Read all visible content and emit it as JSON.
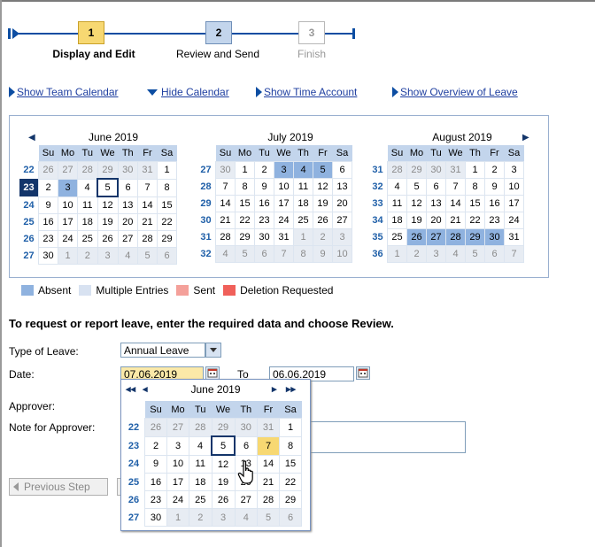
{
  "roadmap": {
    "steps": [
      {
        "num": "1",
        "label": "Display and Edit",
        "state": "active"
      },
      {
        "num": "2",
        "label": "Review and Send",
        "state": "pending"
      },
      {
        "num": "3",
        "label": "Finish",
        "state": "disabled"
      }
    ]
  },
  "links": {
    "team_calendar": "Show Team Calendar",
    "hide_calendar": "Hide Calendar",
    "time_account": "Show Time Account",
    "overview_leave": "Show Overview of Leave"
  },
  "calendar": {
    "weekday_headers": [
      "Su",
      "Mo",
      "Tu",
      "We",
      "Th",
      "Fr",
      "Sa"
    ],
    "months": [
      {
        "title": "June 2019",
        "weeks": [
          {
            "wk": "22",
            "days": [
              [
                "26",
                "o"
              ],
              [
                "27",
                "o"
              ],
              [
                "28",
                "o"
              ],
              [
                "29",
                "o"
              ],
              [
                "30",
                "o"
              ],
              [
                "31",
                "o"
              ],
              [
                "1",
                "d"
              ]
            ]
          },
          {
            "wk": "23",
            "days": [
              [
                "2",
                "d"
              ],
              [
                "3",
                "a"
              ],
              [
                "4",
                "d"
              ],
              [
                "5",
                "t"
              ],
              [
                "6",
                "d"
              ],
              [
                "7",
                "d"
              ],
              [
                "8",
                "d"
              ]
            ]
          },
          {
            "wk": "24",
            "days": [
              [
                "9",
                "d"
              ],
              [
                "10",
                "d"
              ],
              [
                "11",
                "d"
              ],
              [
                "12",
                "d"
              ],
              [
                "13",
                "d"
              ],
              [
                "14",
                "d"
              ],
              [
                "15",
                "d"
              ]
            ]
          },
          {
            "wk": "25",
            "days": [
              [
                "16",
                "d"
              ],
              [
                "17",
                "d"
              ],
              [
                "18",
                "d"
              ],
              [
                "19",
                "d"
              ],
              [
                "20",
                "d"
              ],
              [
                "21",
                "d"
              ],
              [
                "22",
                "d"
              ]
            ]
          },
          {
            "wk": "26",
            "days": [
              [
                "23",
                "d"
              ],
              [
                "24",
                "d"
              ],
              [
                "25",
                "d"
              ],
              [
                "26",
                "d"
              ],
              [
                "27",
                "d"
              ],
              [
                "28",
                "d"
              ],
              [
                "29",
                "d"
              ]
            ]
          },
          {
            "wk": "27",
            "days": [
              [
                "30",
                "d"
              ],
              [
                "1",
                "o"
              ],
              [
                "2",
                "o"
              ],
              [
                "3",
                "o"
              ],
              [
                "4",
                "o"
              ],
              [
                "5",
                "o"
              ],
              [
                "6",
                "o"
              ]
            ]
          }
        ]
      },
      {
        "title": "July 2019",
        "weeks": [
          {
            "wk": "27",
            "days": [
              [
                "30",
                "o"
              ],
              [
                "1",
                "d"
              ],
              [
                "2",
                "d"
              ],
              [
                "3",
                "a"
              ],
              [
                "4",
                "a"
              ],
              [
                "5",
                "a"
              ],
              [
                "6",
                "d"
              ]
            ]
          },
          {
            "wk": "28",
            "days": [
              [
                "7",
                "d"
              ],
              [
                "8",
                "d"
              ],
              [
                "9",
                "d"
              ],
              [
                "10",
                "d"
              ],
              [
                "11",
                "d"
              ],
              [
                "12",
                "d"
              ],
              [
                "13",
                "d"
              ]
            ]
          },
          {
            "wk": "29",
            "days": [
              [
                "14",
                "d"
              ],
              [
                "15",
                "d"
              ],
              [
                "16",
                "d"
              ],
              [
                "17",
                "d"
              ],
              [
                "18",
                "d"
              ],
              [
                "19",
                "d"
              ],
              [
                "20",
                "d"
              ]
            ]
          },
          {
            "wk": "30",
            "days": [
              [
                "21",
                "d"
              ],
              [
                "22",
                "d"
              ],
              [
                "23",
                "d"
              ],
              [
                "24",
                "d"
              ],
              [
                "25",
                "d"
              ],
              [
                "26",
                "d"
              ],
              [
                "27",
                "d"
              ]
            ]
          },
          {
            "wk": "31",
            "days": [
              [
                "28",
                "d"
              ],
              [
                "29",
                "d"
              ],
              [
                "30",
                "d"
              ],
              [
                "31",
                "d"
              ],
              [
                "1",
                "o"
              ],
              [
                "2",
                "o"
              ],
              [
                "3",
                "o"
              ]
            ]
          },
          {
            "wk": "32",
            "days": [
              [
                "4",
                "o"
              ],
              [
                "5",
                "o"
              ],
              [
                "6",
                "o"
              ],
              [
                "7",
                "o"
              ],
              [
                "8",
                "o"
              ],
              [
                "9",
                "o"
              ],
              [
                "10",
                "o"
              ]
            ]
          }
        ]
      },
      {
        "title": "August 2019",
        "weeks": [
          {
            "wk": "31",
            "days": [
              [
                "28",
                "o"
              ],
              [
                "29",
                "o"
              ],
              [
                "30",
                "o"
              ],
              [
                "31",
                "o"
              ],
              [
                "1",
                "d"
              ],
              [
                "2",
                "d"
              ],
              [
                "3",
                "d"
              ]
            ]
          },
          {
            "wk": "32",
            "days": [
              [
                "4",
                "d"
              ],
              [
                "5",
                "d"
              ],
              [
                "6",
                "d"
              ],
              [
                "7",
                "d"
              ],
              [
                "8",
                "d"
              ],
              [
                "9",
                "d"
              ],
              [
                "10",
                "d"
              ]
            ]
          },
          {
            "wk": "33",
            "days": [
              [
                "11",
                "d"
              ],
              [
                "12",
                "d"
              ],
              [
                "13",
                "d"
              ],
              [
                "14",
                "d"
              ],
              [
                "15",
                "d"
              ],
              [
                "16",
                "d"
              ],
              [
                "17",
                "d"
              ]
            ]
          },
          {
            "wk": "34",
            "days": [
              [
                "18",
                "d"
              ],
              [
                "19",
                "d"
              ],
              [
                "20",
                "d"
              ],
              [
                "21",
                "d"
              ],
              [
                "22",
                "d"
              ],
              [
                "23",
                "d"
              ],
              [
                "24",
                "d"
              ]
            ]
          },
          {
            "wk": "35",
            "days": [
              [
                "25",
                "d"
              ],
              [
                "26",
                "a"
              ],
              [
                "27",
                "a"
              ],
              [
                "28",
                "a"
              ],
              [
                "29",
                "a"
              ],
              [
                "30",
                "a"
              ],
              [
                "31",
                "d"
              ]
            ]
          },
          {
            "wk": "36",
            "days": [
              [
                "1",
                "o"
              ],
              [
                "2",
                "o"
              ],
              [
                "3",
                "o"
              ],
              [
                "4",
                "o"
              ],
              [
                "5",
                "o"
              ],
              [
                "6",
                "o"
              ],
              [
                "7",
                "o"
              ]
            ]
          }
        ]
      }
    ]
  },
  "legend": [
    {
      "label": "Absent",
      "color": "#8fb2df"
    },
    {
      "label": "Multiple Entries",
      "color": "#d8e2f1"
    },
    {
      "label": "Sent",
      "color": "#f4a09a"
    },
    {
      "label": "Deletion Requested",
      "color": "#f0605a"
    }
  ],
  "form": {
    "instruction": "To request or report leave, enter the required data and choose Review.",
    "type_label": "Type of Leave:",
    "type_value": "Annual Leave",
    "date_label": "Date:",
    "date_from": "07.06.2019",
    "to_label": "To",
    "date_to": "06.06.2019",
    "approver_label": "Approver:",
    "note_label": "Note for Approver:",
    "prev_button": "Previous Step"
  },
  "popup": {
    "title": "June 2019",
    "nav_prev_year": "◂◂",
    "nav_prev": "◂",
    "nav_next": "▸",
    "nav_next_year": "▸▸",
    "weekday_headers": [
      "Su",
      "Mo",
      "Tu",
      "We",
      "Th",
      "Fr",
      "Sa"
    ],
    "weeks": [
      {
        "wk": "22",
        "days": [
          [
            "26",
            "o"
          ],
          [
            "27",
            "o"
          ],
          [
            "28",
            "o"
          ],
          [
            "29",
            "o"
          ],
          [
            "30",
            "o"
          ],
          [
            "31",
            "o"
          ],
          [
            "1",
            "d"
          ]
        ]
      },
      {
        "wk": "23",
        "days": [
          [
            "2",
            "d"
          ],
          [
            "3",
            "d"
          ],
          [
            "4",
            "d"
          ],
          [
            "5",
            "t"
          ],
          [
            "6",
            "d"
          ],
          [
            "7",
            "s"
          ],
          [
            "8",
            "d"
          ]
        ]
      },
      {
        "wk": "24",
        "days": [
          [
            "9",
            "d"
          ],
          [
            "10",
            "d"
          ],
          [
            "11",
            "d"
          ],
          [
            "12",
            "d"
          ],
          [
            "13",
            "d"
          ],
          [
            "14",
            "d"
          ],
          [
            "15",
            "d"
          ]
        ]
      },
      {
        "wk": "25",
        "days": [
          [
            "16",
            "d"
          ],
          [
            "17",
            "d"
          ],
          [
            "18",
            "d"
          ],
          [
            "19",
            "d"
          ],
          [
            "20",
            "d"
          ],
          [
            "21",
            "d"
          ],
          [
            "22",
            "d"
          ]
        ]
      },
      {
        "wk": "26",
        "days": [
          [
            "23",
            "d"
          ],
          [
            "24",
            "d"
          ],
          [
            "25",
            "d"
          ],
          [
            "26",
            "d"
          ],
          [
            "27",
            "d"
          ],
          [
            "28",
            "d"
          ],
          [
            "29",
            "d"
          ]
        ]
      },
      {
        "wk": "27",
        "days": [
          [
            "30",
            "d"
          ],
          [
            "1",
            "o"
          ],
          [
            "2",
            "o"
          ],
          [
            "3",
            "o"
          ],
          [
            "4",
            "o"
          ],
          [
            "5",
            "o"
          ],
          [
            "6",
            "o"
          ]
        ]
      }
    ]
  }
}
